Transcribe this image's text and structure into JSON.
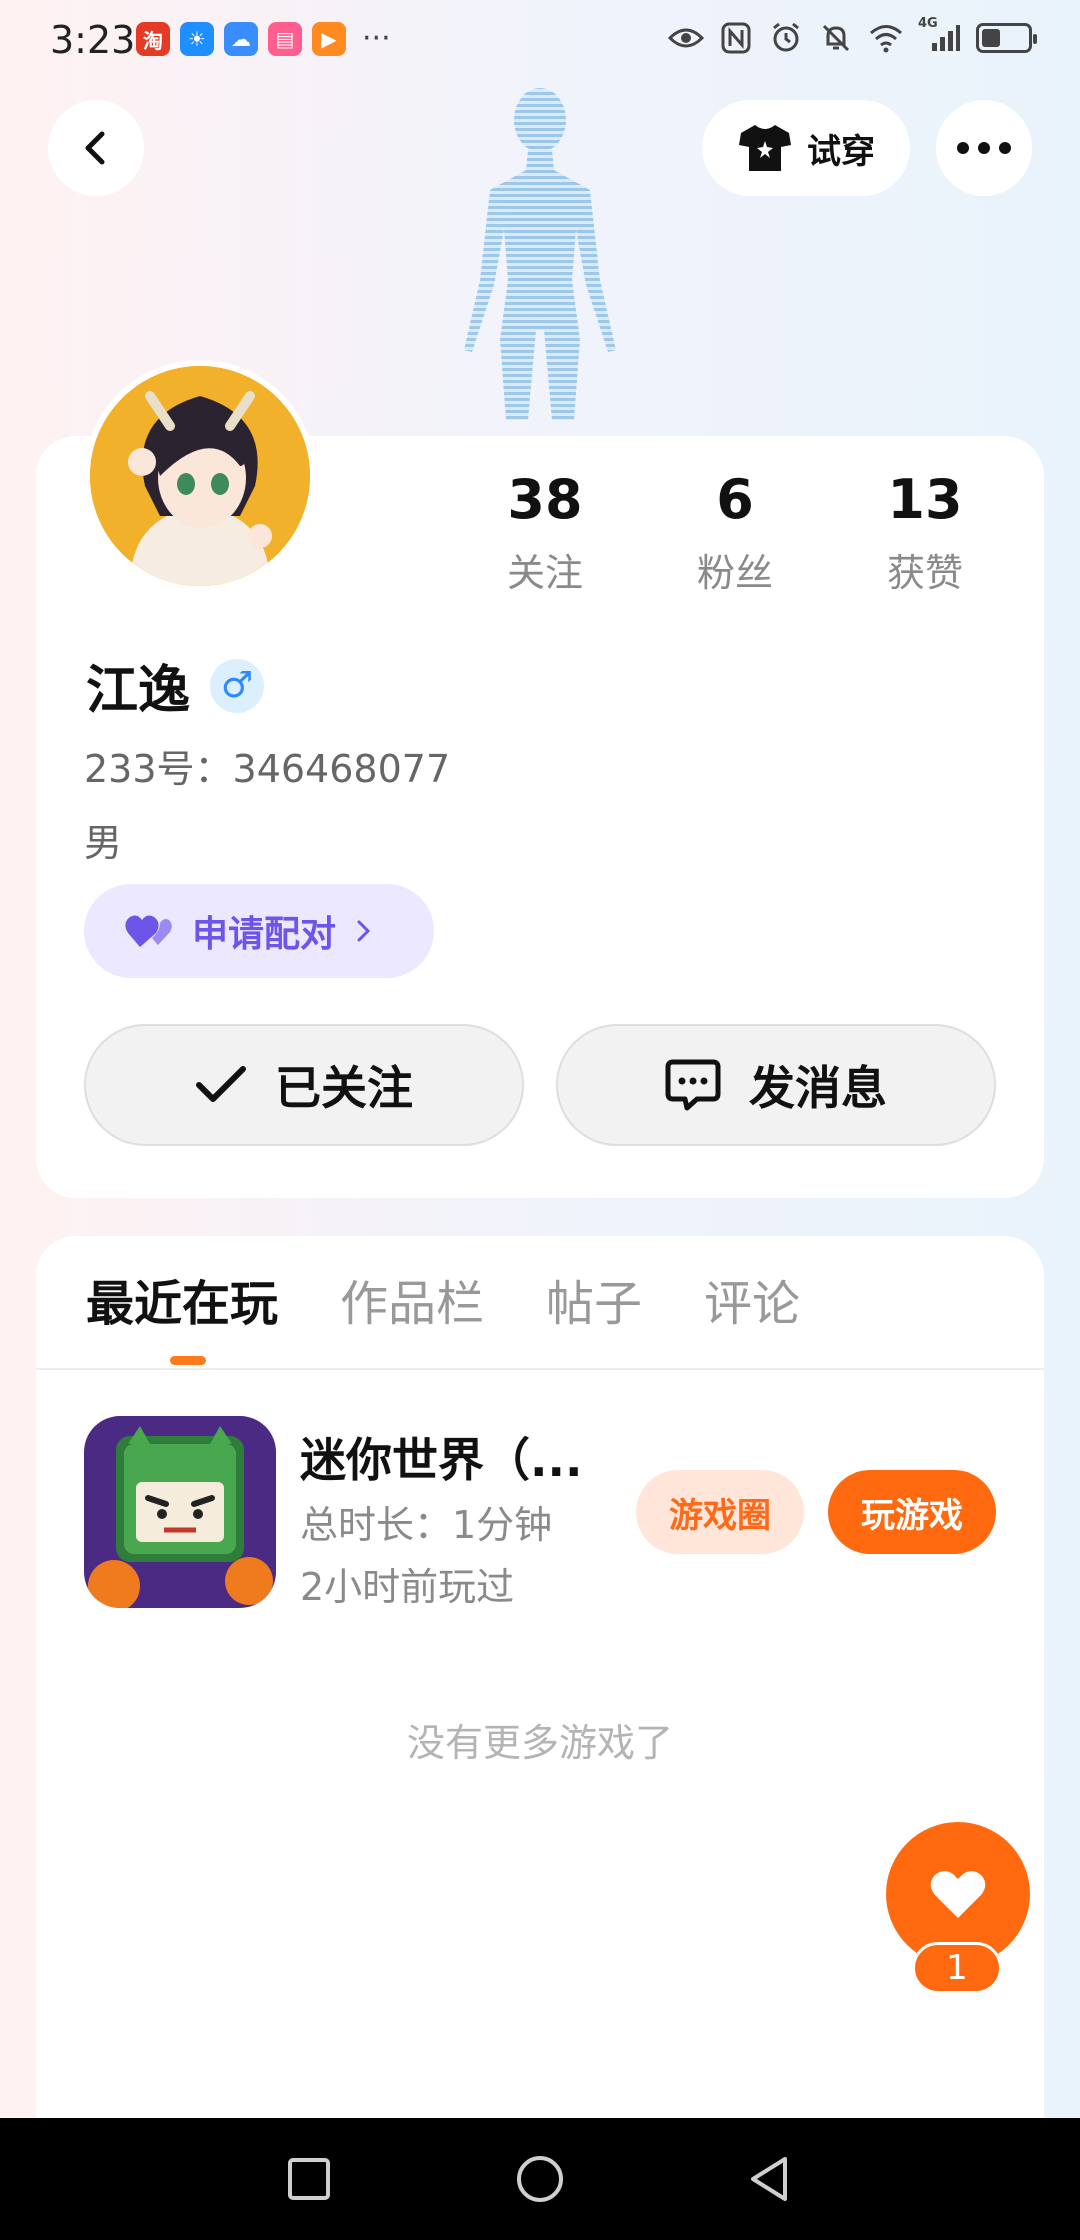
{
  "status_bar": {
    "time": "3:23",
    "notification_apps": [
      {
        "icon": "taobao-icon",
        "glyph": "淘",
        "color": "#e33b25"
      },
      {
        "icon": "weather-icon",
        "glyph": "☀",
        "color": "#1f8fff"
      },
      {
        "icon": "cloud-icon",
        "glyph": "☁",
        "color": "#3a8dff"
      },
      {
        "icon": "notes-app-icon",
        "glyph": "▤",
        "color": "#ff5e8e"
      },
      {
        "icon": "video-app-icon",
        "glyph": "▶",
        "color": "#ff8a1f"
      }
    ],
    "more": "···",
    "network": "4G",
    "battery_level": 0.4
  },
  "top_bar": {
    "try_on_label": "试穿"
  },
  "profile": {
    "stats": [
      {
        "value": "38",
        "label": "关注"
      },
      {
        "value": "6",
        "label": "粉丝"
      },
      {
        "value": "13",
        "label": "获赞"
      }
    ],
    "name": "江逸",
    "gender_symbol": "♂",
    "id_text": "233号：346468077",
    "gender_text": "男",
    "pair_label": "申请配对",
    "follow_label": "已关注",
    "message_label": "发消息"
  },
  "tabs": [
    {
      "label": "最近在玩",
      "active": true
    },
    {
      "label": "作品栏",
      "active": false
    },
    {
      "label": "帖子",
      "active": false
    },
    {
      "label": "评论",
      "active": false
    }
  ],
  "game": {
    "title": "迷你世界（...",
    "duration": "总时长：1分钟",
    "last_played": "2小时前玩过",
    "circle_label": "游戏圈",
    "play_label": "玩游戏"
  },
  "no_more_text": "没有更多游戏了",
  "fab": {
    "count": "1"
  },
  "colors": {
    "accent": "#ff6a10",
    "pair_purple": "#6c55e8"
  }
}
